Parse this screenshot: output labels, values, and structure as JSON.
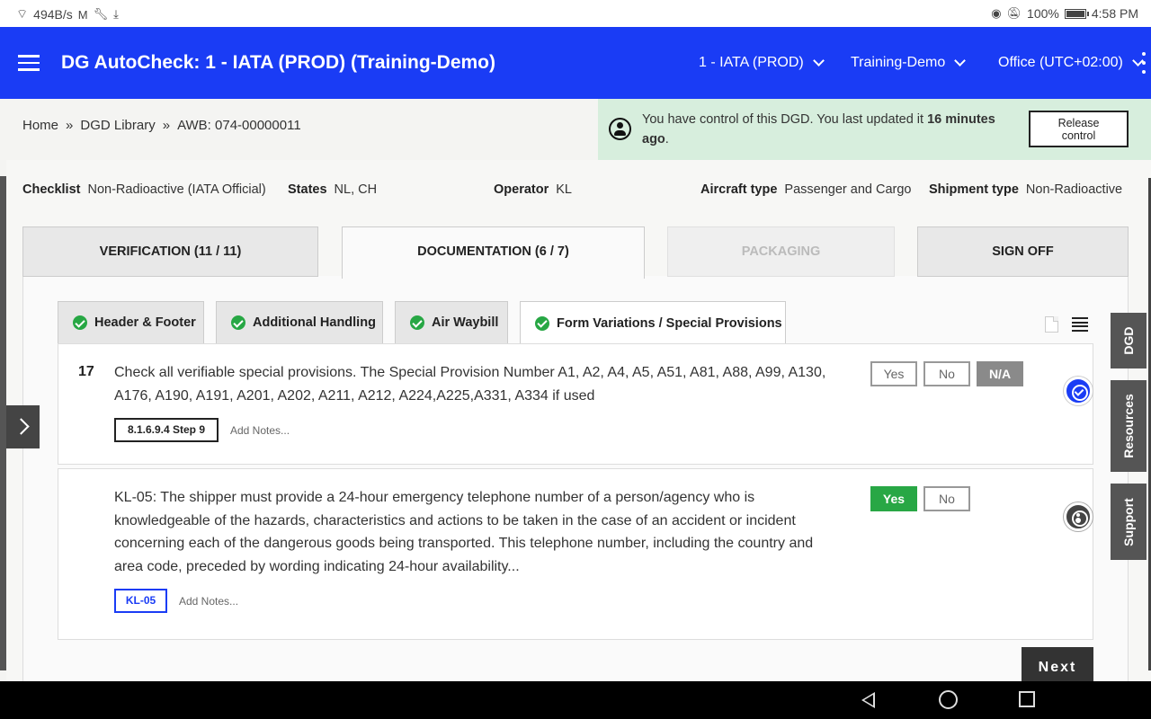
{
  "status_bar": {
    "net_speed": "494B/s",
    "battery": "100%",
    "time": "4:58 PM"
  },
  "header": {
    "title": "DG AutoCheck: 1 - IATA (PROD) (Training-Demo)",
    "dropdowns": [
      "1 - IATA (PROD)",
      "Training-Demo",
      "Office (UTC+02:00)"
    ]
  },
  "breadcrumb": {
    "items": [
      "Home",
      "DGD Library",
      "AWB: 074-00000011"
    ],
    "separator": "»"
  },
  "control_banner": {
    "text_prefix": "You have control of this DGD. You last updated it ",
    "text_bold": "16 minutes ago",
    "text_suffix": ".",
    "release_label_line1": "Release",
    "release_label_line2": "control"
  },
  "meta": {
    "checklist_label": "Checklist",
    "checklist_value": "Non-Radioactive (IATA Official)",
    "states_label": "States",
    "states_value": "NL, CH",
    "operator_label": "Operator",
    "operator_value": "KL",
    "aircraft_label": "Aircraft type",
    "aircraft_value": "Passenger and Cargo",
    "shipment_label": "Shipment type",
    "shipment_value": "Non-Radioactive"
  },
  "main_tabs": [
    {
      "label": "VERIFICATION (11 / 11)",
      "state": "normal"
    },
    {
      "label": "DOCUMENTATION (6 / 7)",
      "state": "active"
    },
    {
      "label": "PACKAGING",
      "state": "disabled"
    },
    {
      "label": "SIGN OFF",
      "state": "normal"
    }
  ],
  "sub_tabs": [
    {
      "label": "Header & Footer"
    },
    {
      "label": "Additional Handling"
    },
    {
      "label": "Air Waybill"
    },
    {
      "label": "Form Variations / Special Provisions",
      "active": true
    }
  ],
  "questions": [
    {
      "number": "17",
      "line1": "Check all verifiable special provisions. The Special Provision Number A1, A2, A4, A5, A51, A81, A88, A99, A130,",
      "line2": "A176, A190, A191, A201, A202, A211, A212, A224,A225,A331, A334 if used",
      "ref": "8.1.6.9.4 Step 9",
      "add_notes": "Add Notes...",
      "answers": [
        "Yes",
        "No",
        "N/A"
      ],
      "selected": "N/A"
    },
    {
      "number": "",
      "line1": "KL-05: The shipper must provide a 24-hour emergency telephone number of a person/agency who is",
      "line2": "knowledgeable of the hazards, characteristics and actions to be taken in the case of an accident or incident",
      "line3": "concerning each of the dangerous goods being transported. This telephone number, including the country and",
      "line4": "area code, preceded by wording indicating 24-hour availability...",
      "ref": "KL-05",
      "add_notes": "Add Notes...",
      "answers": [
        "Yes",
        "No"
      ],
      "selected": "Yes"
    }
  ],
  "side_tabs": [
    "DGD",
    "Resources",
    "Support"
  ],
  "next_label": "Next",
  "colors": {
    "brand_blue": "#1a3cf5",
    "success_green": "#28a745",
    "banner_green": "#d7eedd"
  }
}
